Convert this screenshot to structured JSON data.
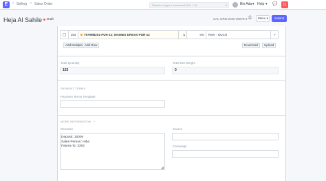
{
  "navbar": {
    "logo": "E",
    "breadcrumbs": [
      "Selling",
      "Sales Order"
    ],
    "search_placeholder": "Search or type a command (Ctrl + G)",
    "user": "Bin Ada",
    "help": "Help",
    "notification_count": "11"
  },
  "header": {
    "title": "Heja Al Sahile",
    "status": "Draft",
    "doc_id": "SAL-ORD-2020-00078-2",
    "menu_label": "Menu",
    "submit_label": "Submit"
  },
  "items": {
    "row": {
      "qty_left": "153",
      "item_name": "7979M8201-PUR-12: MAMBO DRESS-PUR-12",
      "qty": "1",
      "discount": "0%",
      "uom": "Reer - GUCH"
    },
    "add_multiple": "Add Multiple",
    "add_row": "Add Row",
    "download": "Download",
    "upload": "Upload"
  },
  "totals": {
    "total_qty_label": "Total Quantity",
    "total_qty_value": "153",
    "total_weight_label": "Total Net Weight",
    "total_weight_value": "0"
  },
  "payment": {
    "section_title": "PAYMENT TERMS",
    "template_label": "Payment Terms Template"
  },
  "more_info": {
    "section_title": "MORE INFORMATION",
    "remarks_label": "Remarks",
    "remarks_lines": [
      "Deposit: 10000",
      "Sales Person: Hiba",
      "Fatura nb: 2262"
    ],
    "source_label": "Source",
    "campaign_label": "Campaign"
  }
}
